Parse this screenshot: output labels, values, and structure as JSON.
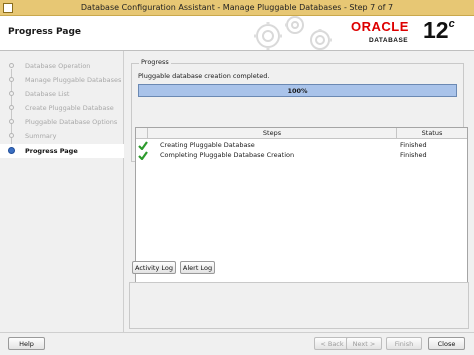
{
  "window": {
    "title": "Database Configuration Assistant - Manage Pluggable Databases - Step 7 of 7"
  },
  "header": {
    "page_title": "Progress Page",
    "brand_oracle": "ORACLE",
    "brand_database": "DATABASE",
    "brand_version": "12",
    "brand_version_suffix": "c"
  },
  "nav": {
    "items": [
      {
        "label": "Database Operation",
        "state": "done"
      },
      {
        "label": "Manage Pluggable Databases",
        "state": "done"
      },
      {
        "label": "Database List",
        "state": "done"
      },
      {
        "label": "Create Pluggable Database",
        "state": "done"
      },
      {
        "label": "Pluggable Database Options",
        "state": "done"
      },
      {
        "label": "Summary",
        "state": "done"
      },
      {
        "label": "Progress Page",
        "state": "active"
      }
    ]
  },
  "progress": {
    "legend": "Progress",
    "status_text": "Pluggable database creation completed.",
    "percent_label": "100%",
    "percent_value": 100
  },
  "steps_table": {
    "columns": [
      "Steps",
      "Status"
    ],
    "rows": [
      {
        "step": "Creating Pluggable Database",
        "status": "Finished",
        "icon": "green-check-icon"
      },
      {
        "step": "Completing Pluggable Database Creation",
        "status": "Finished",
        "icon": "green-check-icon"
      }
    ]
  },
  "buttons": {
    "activity_log": "Activity Log",
    "alert_log": "Alert Log",
    "help": "Help",
    "back": "< Back",
    "next": "Next >",
    "finish": "Finish",
    "close": "Close"
  },
  "colors": {
    "titlebar": "#e7c774",
    "oracle_red": "#dd0000",
    "progress_fill": "#a9c3ea",
    "active_step": "#3b6fc2",
    "check_green": "#2e9b2e"
  }
}
